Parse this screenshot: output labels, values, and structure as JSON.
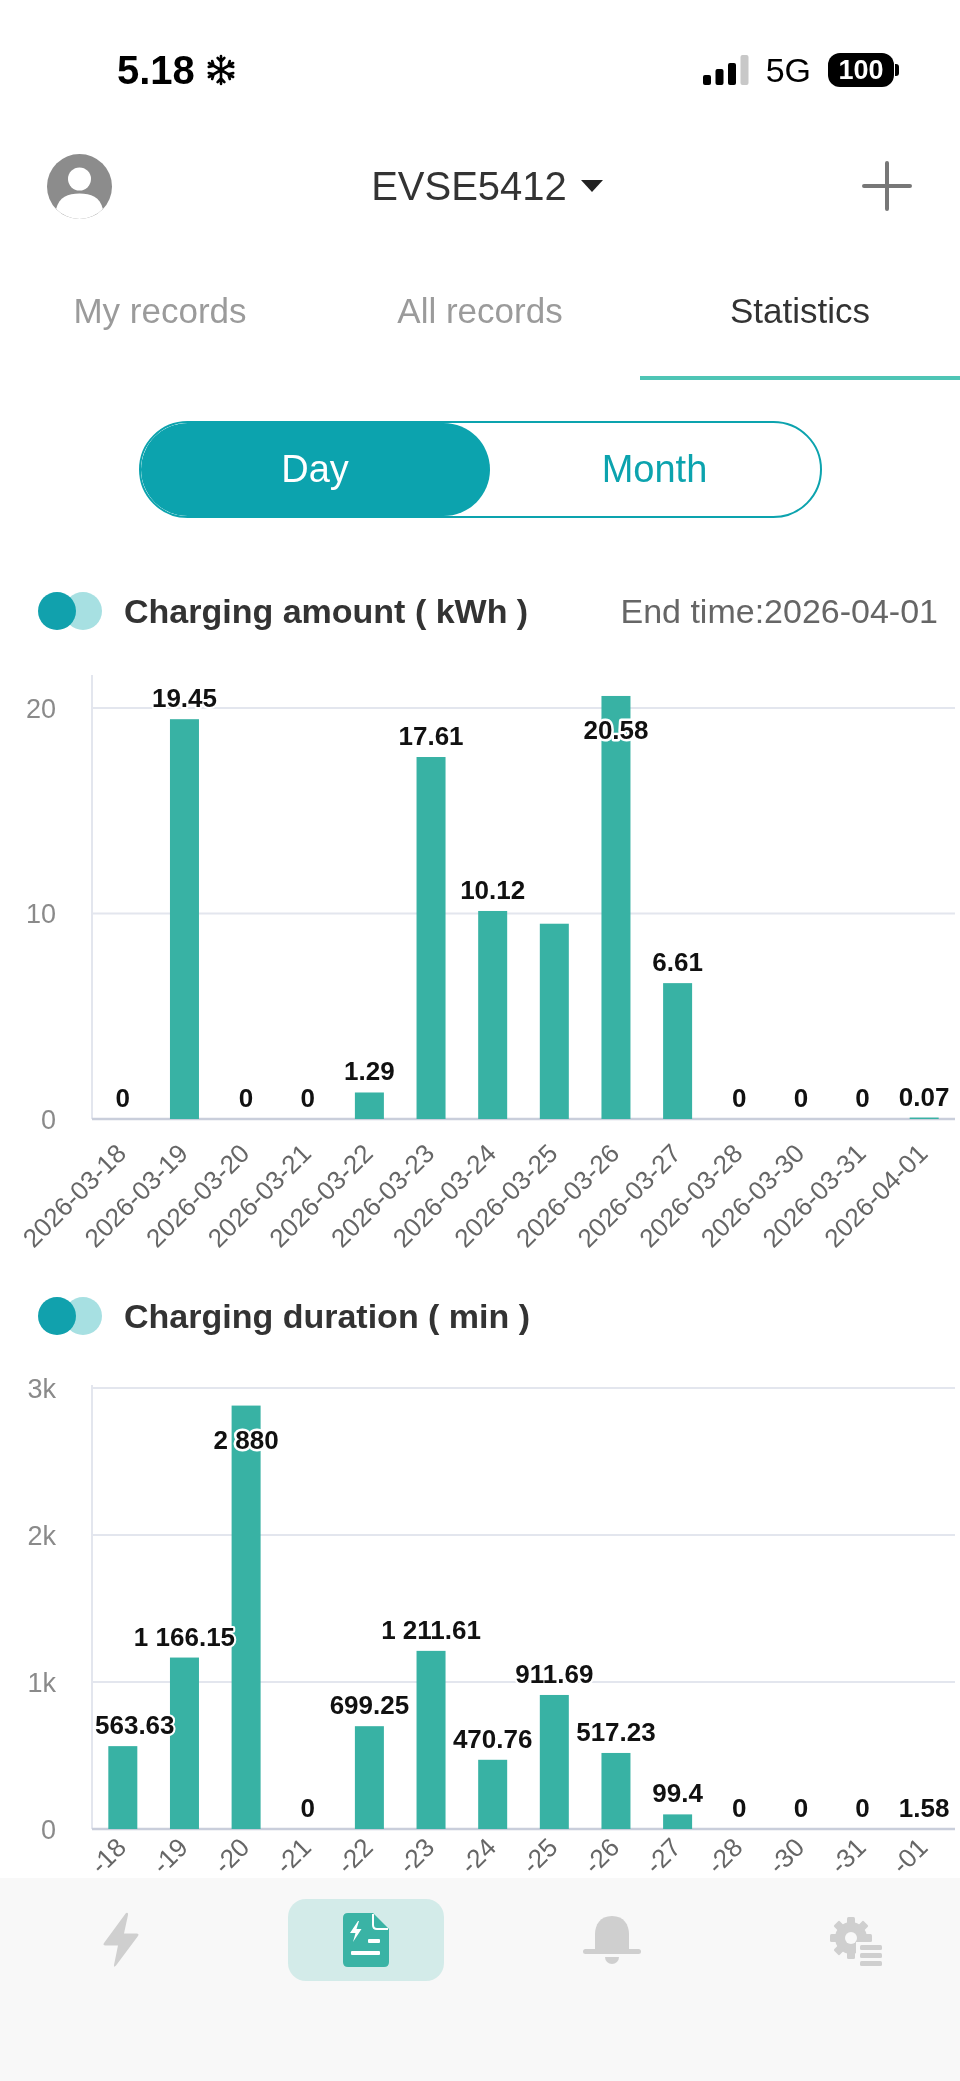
{
  "status_bar": {
    "time": "5.18",
    "network": "5G",
    "battery": "100"
  },
  "header": {
    "device": "EVSE5412"
  },
  "tabs": [
    {
      "label": "My records",
      "selected": false
    },
    {
      "label": "All records",
      "selected": false
    },
    {
      "label": "Statistics",
      "selected": true
    }
  ],
  "period_toggle": [
    {
      "label": "Day",
      "selected": true
    },
    {
      "label": "Month",
      "selected": false
    }
  ],
  "charts": [
    {
      "end_time": "End time:2026-04-01",
      "chart_data": {
        "type": "bar",
        "title": "Charging amount ( kWh )",
        "categories": [
          "2026-03-18",
          "2026-03-19",
          "2026-03-20",
          "2026-03-21",
          "2026-03-22",
          "2026-03-23",
          "2026-03-24",
          "2026-03-25",
          "2026-03-26",
          "2026-03-27",
          "2026-03-28",
          "2026-03-30",
          "2026-03-31",
          "2026-04-01"
        ],
        "values": [
          0,
          19.45,
          0,
          0,
          1.29,
          17.61,
          10.12,
          9.5,
          20.58,
          6.61,
          0,
          0,
          0,
          0.07
        ],
        "ylim": [
          0,
          21.6
        ],
        "yticks": [
          0,
          10,
          20
        ],
        "grid": true,
        "value_labels": [
          "0",
          "19.45",
          "0",
          "0",
          "1.29",
          "17.61",
          "10.12",
          null,
          "20.58",
          "6.61",
          "0",
          "0",
          "0",
          "0.07"
        ]
      }
    },
    {
      "chart_data": {
        "type": "bar",
        "title": "Charging duration ( min )",
        "categories": [
          "-18",
          "-19",
          "-20",
          "-21",
          "-22",
          "-23",
          "-24",
          "-25",
          "-26",
          "-27",
          "-28",
          "-30",
          "-31",
          "-01"
        ],
        "values": [
          563.63,
          1166.15,
          2880,
          0,
          699.25,
          1211.61,
          470.76,
          911.69,
          517.23,
          99.4,
          0,
          0,
          0,
          1.58
        ],
        "ylim": [
          0,
          3020
        ],
        "yticks": [
          {
            "value": 0,
            "label": "0"
          },
          {
            "value": 1000,
            "label": "1k"
          },
          {
            "value": 2000,
            "label": "2k"
          },
          {
            "value": 3000,
            "label": "3k"
          }
        ],
        "grid": true,
        "value_labels": [
          "563.63",
          "1 166.15",
          "2 880",
          "0",
          "699.25",
          "1 211.61",
          "470.76",
          "911.69",
          "517.23",
          "99.4",
          "0",
          "0",
          "0",
          "1.58"
        ]
      }
    }
  ],
  "bottom_nav": [
    {
      "kind": "charge",
      "selected": false
    },
    {
      "kind": "records",
      "selected": true
    },
    {
      "kind": "notifications",
      "selected": false
    },
    {
      "kind": "settings",
      "selected": false
    }
  ]
}
